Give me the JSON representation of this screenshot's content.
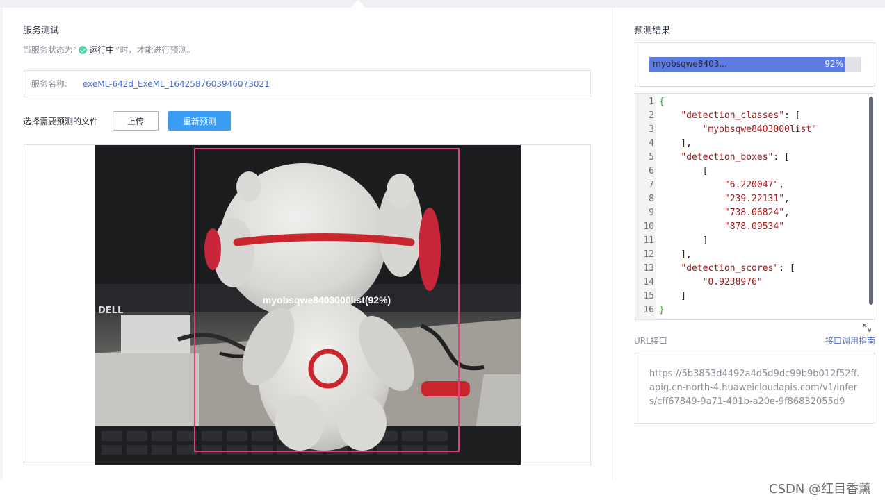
{
  "service_test": {
    "title": "服务测试",
    "hint_prefix": "当服务状态为”",
    "status_text": "运行中",
    "hint_suffix": "”时，才能进行预测。",
    "service_name_label": "服务名称:",
    "service_name_value": "exeML-642d_ExeML_1642587603946073021",
    "file_label": "选择需要预测的文件",
    "upload_button": "上传",
    "repredict_button": "重新预测",
    "detection_label": "myobsqwe8403000list(92%)",
    "photo_brand": "DELL"
  },
  "prediction": {
    "title": "预测结果",
    "class_name": "myobsqwe8403...",
    "percent_label": "92%",
    "score": 0.92,
    "progress_color": "#5e7ce0",
    "code_lines": [
      {
        "n": "1",
        "t": "{"
      },
      {
        "n": "2",
        "t": "    \"detection_classes\": ["
      },
      {
        "n": "3",
        "t": "        \"myobsqwe8403000list\""
      },
      {
        "n": "4",
        "t": "    ],"
      },
      {
        "n": "5",
        "t": "    \"detection_boxes\": ["
      },
      {
        "n": "6",
        "t": "        ["
      },
      {
        "n": "7",
        "t": "            \"6.220047\","
      },
      {
        "n": "8",
        "t": "            \"239.22131\","
      },
      {
        "n": "9",
        "t": "            \"738.06824\","
      },
      {
        "n": "10",
        "t": "            \"878.09534\""
      },
      {
        "n": "11",
        "t": "        ]"
      },
      {
        "n": "12",
        "t": "    ],"
      },
      {
        "n": "13",
        "t": "    \"detection_scores\": ["
      },
      {
        "n": "14",
        "t": "        \"0.9238976\""
      },
      {
        "n": "15",
        "t": "    ]"
      },
      {
        "n": "16",
        "t": "}"
      }
    ]
  },
  "url": {
    "label": "URL接口",
    "guide_link": "接口调用指南",
    "value": "https://5b3853d4492a4d5d9dc99b9b012f52ff.apig.cn-north-4.huaweicloudapis.com/v1/infers/cff67849-9a71-401b-a20e-9f86832055d9"
  },
  "watermark": "CSDN @红目香薰",
  "icons": [
    "check-circle-icon",
    "expand-icon"
  ],
  "colors": {
    "accent": "#3b9cf4",
    "link": "#526ecc",
    "status_green": "#50d4ab",
    "detection_box": "#e2407b"
  }
}
